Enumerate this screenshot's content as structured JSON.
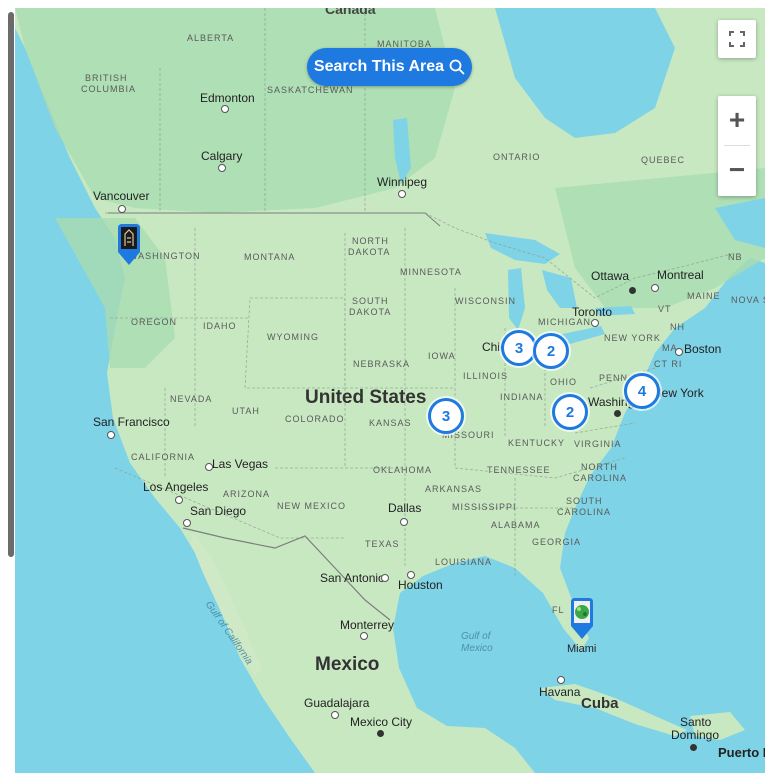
{
  "search": {
    "label": "Search This Area"
  },
  "controls": {
    "zoom_in": "+",
    "zoom_out": "−"
  },
  "clusters": [
    {
      "id": "chicago",
      "count": "3"
    },
    {
      "id": "michigan",
      "count": "2"
    },
    {
      "id": "kansas-city",
      "count": "3"
    },
    {
      "id": "west-virginia",
      "count": "2"
    },
    {
      "id": "new-jersey",
      "count": "4"
    }
  ],
  "labels": {
    "canada": "Canada",
    "alberta": "ALBERTA",
    "british_columbia_1": "BRITISH",
    "british_columbia_2": "COLUMBIA",
    "saskatchewan": "SASKATCHEWAN",
    "manitoba": "MANITOBA",
    "ontario": "ONTARIO",
    "quebec": "QUEBEC",
    "nb": "NB",
    "nova_scotia": "NOVA S",
    "maine": "MAINE",
    "vt": "VT",
    "nh": "NH",
    "ma": "MA",
    "ct_ri": "CT RI",
    "edmonton": "Edmonton",
    "calgary": "Calgary",
    "vancouver": "Vancouver",
    "winnipeg": "Winnipeg",
    "ottawa": "Ottawa",
    "montreal": "Montreal",
    "toronto": "Toronto",
    "boston": "Boston",
    "new_york_state": "NEW YORK",
    "new_york_city": "New York",
    "washington_state": "WASHINGTON",
    "montana": "MONTANA",
    "north_dakota_1": "NORTH",
    "north_dakota_2": "DAKOTA",
    "minnesota": "MINNESOTA",
    "oregon": "OREGON",
    "idaho": "IDAHO",
    "wyoming": "WYOMING",
    "south_dakota_1": "SOUTH",
    "south_dakota_2": "DAKOTA",
    "wisconsin": "WISCONSIN",
    "michigan": "MICHIGAN",
    "iowa": "IOWA",
    "nebraska": "NEBRASKA",
    "chicago": "Chicago",
    "illinois": "ILLINOIS",
    "ohio": "OHIO",
    "indiana": "INDIANA",
    "penn": "PENN",
    "washington_dc": "Washington",
    "nevada": "NEVADA",
    "utah": "UTAH",
    "colorado": "COLORADO",
    "united_states": "United States",
    "kansas": "KANSAS",
    "missouri": "MISSOURI",
    "kentucky": "KENTUCKY",
    "virginia": "VIRGINIA",
    "san_francisco": "San Francisco",
    "california": "CALIFORNIA",
    "las_vegas": "Las Vegas",
    "oklahoma": "OKLAHOMA",
    "tennessee": "TENNESSEE",
    "north_carolina_1": "NORTH",
    "north_carolina_2": "CAROLINA",
    "los_angeles": "Los Angeles",
    "arizona": "ARIZONA",
    "san_diego": "San Diego",
    "new_mexico": "NEW MEXICO",
    "arkansas": "ARKANSAS",
    "mississippi": "MISSISSIPPI",
    "dallas": "Dallas",
    "south_carolina_1": "SOUTH",
    "south_carolina_2": "CAROLINA",
    "alabama": "ALABAMA",
    "georgia": "GEORGIA",
    "texas": "TEXAS",
    "louisiana": "LOUISIANA",
    "san_antonio": "San Antonio",
    "houston": "Houston",
    "gulf_of_california": "Gulf of California",
    "florida": "FL",
    "monterrey": "Monterrey",
    "gulf_mexico_1": "Gulf of",
    "gulf_mexico_2": "Mexico",
    "miami": "Miami",
    "mexico": "Mexico",
    "havana": "Havana",
    "cuba": "Cuba",
    "guadalajara": "Guadalajara",
    "mexico_city": "Mexico City",
    "santo_domingo_1": "Santo",
    "santo_domingo_2": "Domingo",
    "puerto_rico": "Puerto R"
  },
  "colors": {
    "water": "#7fd3e6",
    "land": "#c8e8c2",
    "forest": "#a9dcb0",
    "accent": "#1e79e0"
  }
}
